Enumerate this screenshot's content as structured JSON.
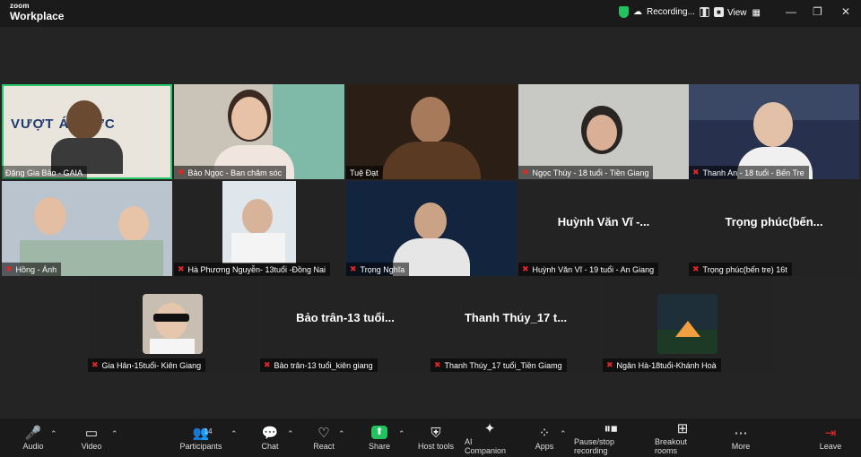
{
  "app": {
    "brand_small": "zoom",
    "brand_big": "Workplace"
  },
  "top": {
    "recording": "Recording...",
    "view": "View"
  },
  "participants": [
    {
      "label": "Đặng Gia Bảo - GAIA",
      "muted": false,
      "active": true,
      "overlay": "VƯỢT ÁP LỰC"
    },
    {
      "label": "Bảo Ngọc - Ban chăm sóc",
      "muted": true
    },
    {
      "label": "Tuệ Đạt",
      "muted": false
    },
    {
      "label": "Ngọc Thúy - 18 tuổi - Tiền Giang",
      "muted": true
    },
    {
      "label": "Thanh An - 18 tuổi - Bến Tre",
      "muted": true
    },
    {
      "label": "Hồng - Ánh",
      "muted": true
    },
    {
      "label": "Hà Phương Nguyễn- 13tuổi -Đồng Nai",
      "muted": true
    },
    {
      "label": "Trọng Nghĩa",
      "muted": true
    },
    {
      "label": "Huỳnh Văn Vĩ - 19 tuổi - An Giang",
      "muted": true,
      "big": "Huỳnh Văn Vĩ -..."
    },
    {
      "label": "Trọng phúc(bến tre) 16t",
      "muted": true,
      "big": "Trọng  phúc(bến..."
    },
    {
      "label": "Gia Hân-15tuổi- Kiên Giang",
      "muted": true
    },
    {
      "label": "Bảo trân-13 tuổi_kiên giang",
      "muted": true,
      "big": "Bảo trân-13 tuổi..."
    },
    {
      "label": "Thanh Thúy_17 tuổi_Tiền Giamg",
      "muted": true,
      "big": "Thanh Thúy_17 t..."
    },
    {
      "label": "Ngân Hà-18tuổi-Khánh Hoà",
      "muted": true
    }
  ],
  "toolbar": {
    "audio": "Audio",
    "video": "Video",
    "participants": "Participants",
    "participants_count": "14",
    "chat": "Chat",
    "react": "React",
    "share": "Share",
    "host_tools": "Host tools",
    "ai": "AI Companion",
    "apps": "Apps",
    "pause": "Pause/stop recording",
    "breakout": "Breakout rooms",
    "more": "More",
    "leave": "Leave"
  },
  "icons": {
    "mic_muted": "🎤",
    "caret": "⌃"
  }
}
